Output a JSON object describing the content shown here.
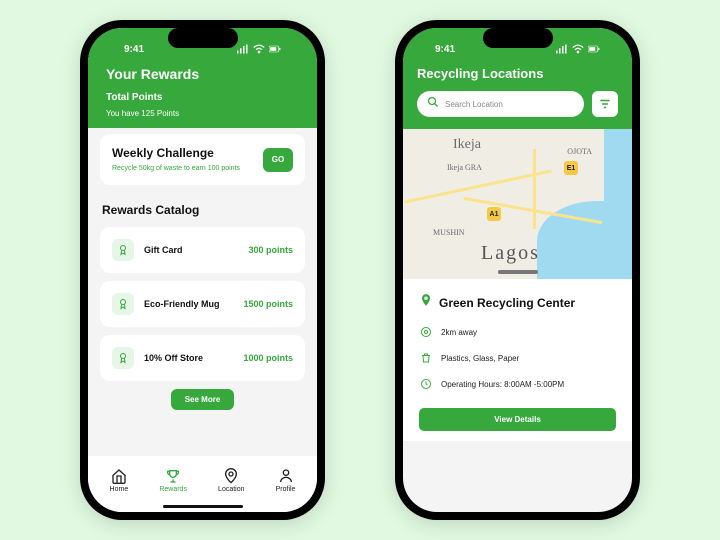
{
  "status": {
    "time": "9:41"
  },
  "rewards": {
    "title": "Your Rewards",
    "subtitle": "Total Points",
    "points_line": "You have 125 Points",
    "challenge": {
      "title": "Weekly Challenge",
      "desc": "Recycle 50kg of waste to earn 100 points",
      "go": "GO"
    },
    "catalog_title": "Rewards Catalog",
    "items": [
      {
        "label": "Gift Card",
        "points": "300 points"
      },
      {
        "label": "Eco-Friendly Mug",
        "points": "1500 points"
      },
      {
        "label": "10% Off Store",
        "points": "1000 points"
      }
    ],
    "see_more": "See More",
    "nav": {
      "home": "Home",
      "rewards": "Rewards",
      "location": "Location",
      "profile": "Profile"
    }
  },
  "locations": {
    "title": "Recycling Locations",
    "search_placeholder": "Search Location",
    "map_labels": {
      "ikeja": "Ikeja",
      "ojota": "OJOTA",
      "gra": "Ikeja GRA",
      "mushin": "MUSHIN",
      "lagos": "Lagos",
      "e1": "E1",
      "a1": "A1"
    },
    "center": {
      "name": "Green Recycling Center",
      "distance": "2km away",
      "materials": "Plastics, Glass, Paper",
      "hours": "Operating Hours: 8:00AM -5:00PM",
      "view": "View Details"
    }
  }
}
